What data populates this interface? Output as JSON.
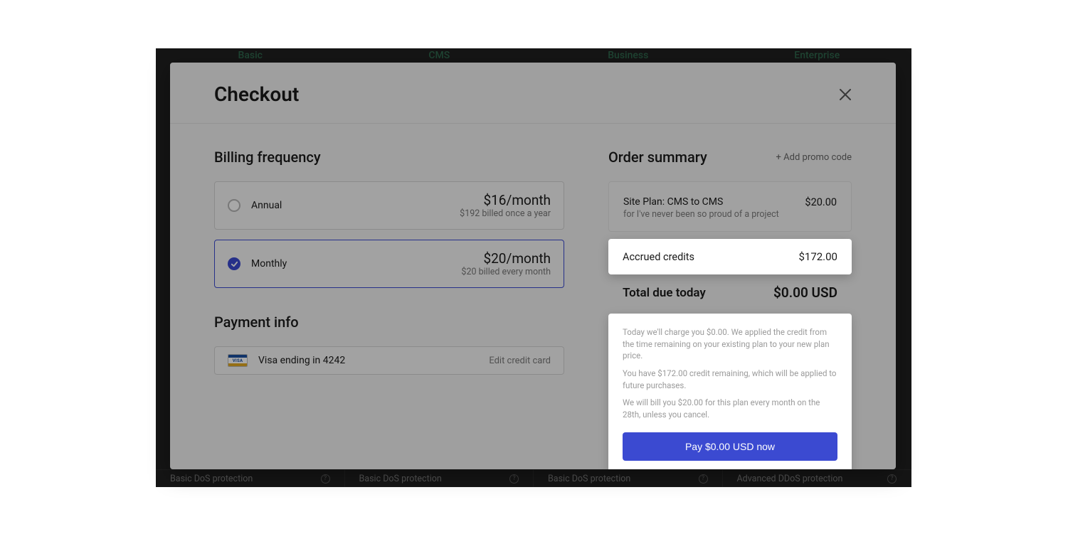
{
  "background": {
    "plan_tabs": [
      "Basic",
      "CMS",
      "Business",
      "Enterprise"
    ],
    "bottom_cells": [
      {
        "label": "Basic DoS protection"
      },
      {
        "label": "Basic DoS protection"
      },
      {
        "label": "Basic DoS protection"
      },
      {
        "label": "Advanced DDoS protection"
      }
    ]
  },
  "modal": {
    "title": "Checkout",
    "billing": {
      "title": "Billing frequency",
      "options": [
        {
          "name": "Annual",
          "price": "$16/month",
          "sub": "$192 billed once a year",
          "selected": false
        },
        {
          "name": "Monthly",
          "price": "$20/month",
          "sub": "$20 billed every month",
          "selected": true
        }
      ]
    },
    "payment": {
      "title": "Payment info",
      "card_brand": "VISA",
      "card_label": "Visa ending in 4242",
      "edit_label": "Edit credit card"
    },
    "summary": {
      "title": "Order summary",
      "add_promo": "+ Add promo code",
      "line_item": {
        "name": "Site Plan: CMS to CMS",
        "sub": "for I've never been so proud of a project",
        "amount": "$20.00"
      },
      "credits": {
        "label": "Accrued credits",
        "amount": "$172.00"
      },
      "total": {
        "label": "Total due today",
        "amount": "$0.00 USD"
      },
      "notes": [
        "Today we'll charge you $0.00. We applied the credit from the time remaining on your existing plan to your new plan price.",
        "You have $172.00 credit remaining, which will be applied to future purchases.",
        "We will bill you $20.00 for this plan every month on the 28th, unless you cancel."
      ],
      "pay_button": "Pay $0.00 USD now"
    }
  }
}
